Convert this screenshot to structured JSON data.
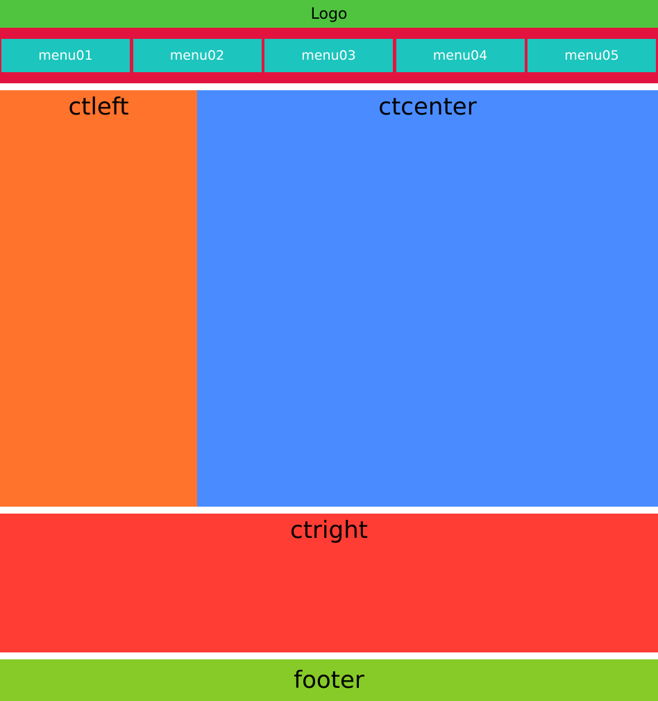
{
  "header": {
    "logo_text": "Logo"
  },
  "nav": {
    "items": [
      {
        "label": "menu01"
      },
      {
        "label": "menu02"
      },
      {
        "label": "menu03"
      },
      {
        "label": "menu04"
      },
      {
        "label": "menu05"
      }
    ]
  },
  "content": {
    "left_label": "ctleft",
    "center_label": "ctcenter",
    "right_label": "ctright"
  },
  "footer": {
    "label": "footer"
  },
  "colors": {
    "logo_bg": "#50c43f",
    "nav_bg": "#e2143f",
    "menu_item_bg": "#1cc5bd",
    "ctleft_bg": "#ff732d",
    "ctcenter_bg": "#4a8cff",
    "ctright_bg": "#ff3d35",
    "footer_bg": "#87cb29"
  }
}
